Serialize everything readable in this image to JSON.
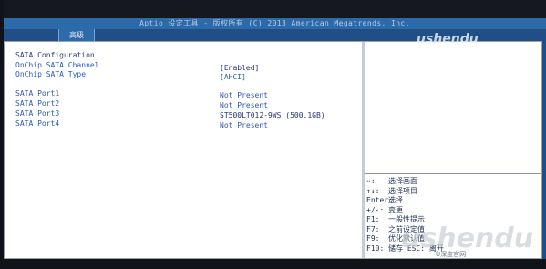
{
  "bios": {
    "title": "Aptio 设定工具 - 版权所有 (C) 2013 American Megatrends, Inc.",
    "tab": "高级",
    "settings": [
      {
        "label": "SATA Configuration",
        "value": "",
        "style": "heading"
      },
      {
        "label": "OnChip SATA Channel",
        "value": "[Enabled]",
        "style": "blue"
      },
      {
        "label": "OnChip SATA Type",
        "value": "[AHCI]",
        "style": "blue"
      },
      {
        "label": "SATA Port1",
        "value": "Not Present",
        "style": "blue"
      },
      {
        "label": "SATA Port2",
        "value": "Not Present",
        "style": "blue"
      },
      {
        "label": "SATA Port3",
        "value": "ST500LT012-9WS (500.1GB)",
        "style": "blue"
      },
      {
        "label": "SATA Port4",
        "value": "Not Present",
        "style": "blue"
      }
    ],
    "help": [
      {
        "key": "↔:",
        "text": "选择画面"
      },
      {
        "key": "↑↓:",
        "text": "选择项目"
      },
      {
        "key": "Enter:",
        "text": "选择"
      },
      {
        "key": "+/-:",
        "text": "变更"
      },
      {
        "key": "F1:",
        "text": "一般性提示"
      },
      {
        "key": "F7:",
        "text": "之前设定值"
      },
      {
        "key": "F9:",
        "text": "优化默认值"
      },
      {
        "key": "F10:",
        "text": "储存   ESC: 离开"
      }
    ]
  },
  "watermark": {
    "brand": "ushendu",
    "brand_large": "ushendu",
    "sub": "U深度官网"
  }
}
